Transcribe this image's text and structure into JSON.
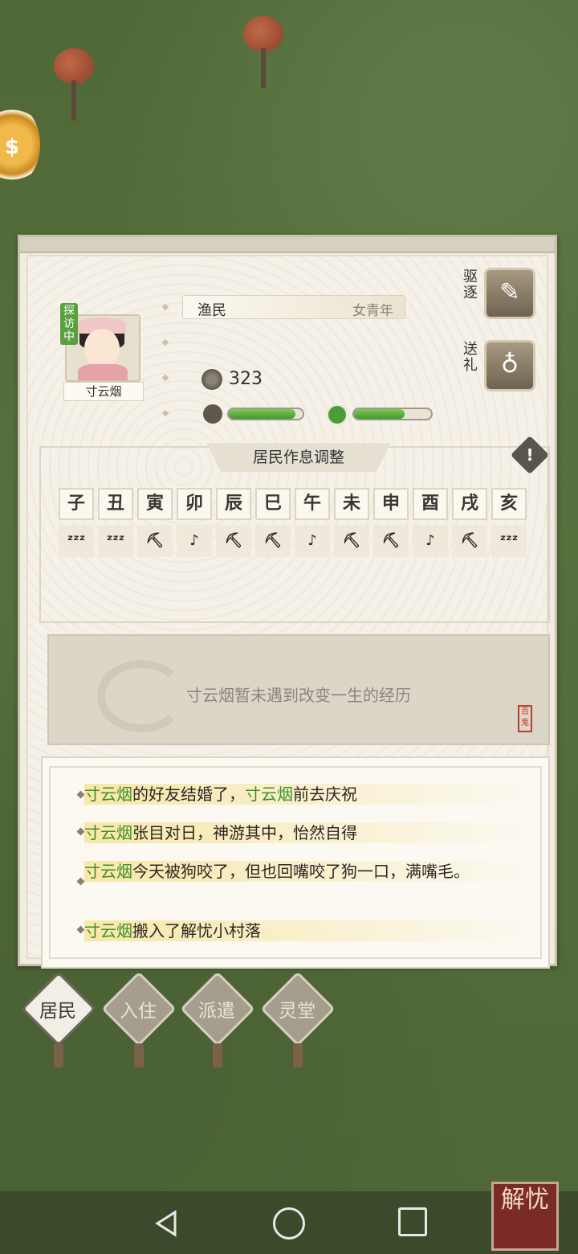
{
  "resident": {
    "name": "寸云烟",
    "visit_tag": "探访中",
    "role": "渔民",
    "age_group": "女青年",
    "money": "323",
    "health_level": 0.9,
    "mood_level": 0.66
  },
  "actions": {
    "expel_label": "驱逐",
    "gift_label": "送礼"
  },
  "schedule": {
    "title": "居民作息调整",
    "hours": [
      "子",
      "丑",
      "寅",
      "卯",
      "辰",
      "巳",
      "午",
      "未",
      "申",
      "酉",
      "戌",
      "亥"
    ],
    "activities": [
      "sleep",
      "sleep",
      "work",
      "rest",
      "work",
      "work",
      "rest",
      "work",
      "work",
      "rest",
      "work",
      "sleep"
    ],
    "activity_glyphs": {
      "sleep": "ᶻᶻᶻ",
      "work": "⛏",
      "rest": "♪"
    }
  },
  "life_event": {
    "text": "寸云烟暂未遇到改变一生的经历",
    "stamp": "百鬼"
  },
  "log": [
    {
      "name": "寸云烟",
      "text": "的好友结婚了，",
      "name2": "寸云烟",
      "text2": "前去庆祝"
    },
    {
      "name": "寸云烟",
      "text": "张目对日，神游其中，怡然自得"
    },
    {
      "name": "寸云烟",
      "text": "今天被狗咬了，但也回嘴咬了狗一口，满嘴毛。"
    },
    {
      "name": "寸云烟",
      "text": "搬入了解忧小村落"
    }
  ],
  "tabs": [
    {
      "label": "居民",
      "active": true
    },
    {
      "label": "入住",
      "active": false
    },
    {
      "label": "派遣",
      "active": false
    },
    {
      "label": "灵堂",
      "active": false
    }
  ],
  "corner_badge": "解忧"
}
